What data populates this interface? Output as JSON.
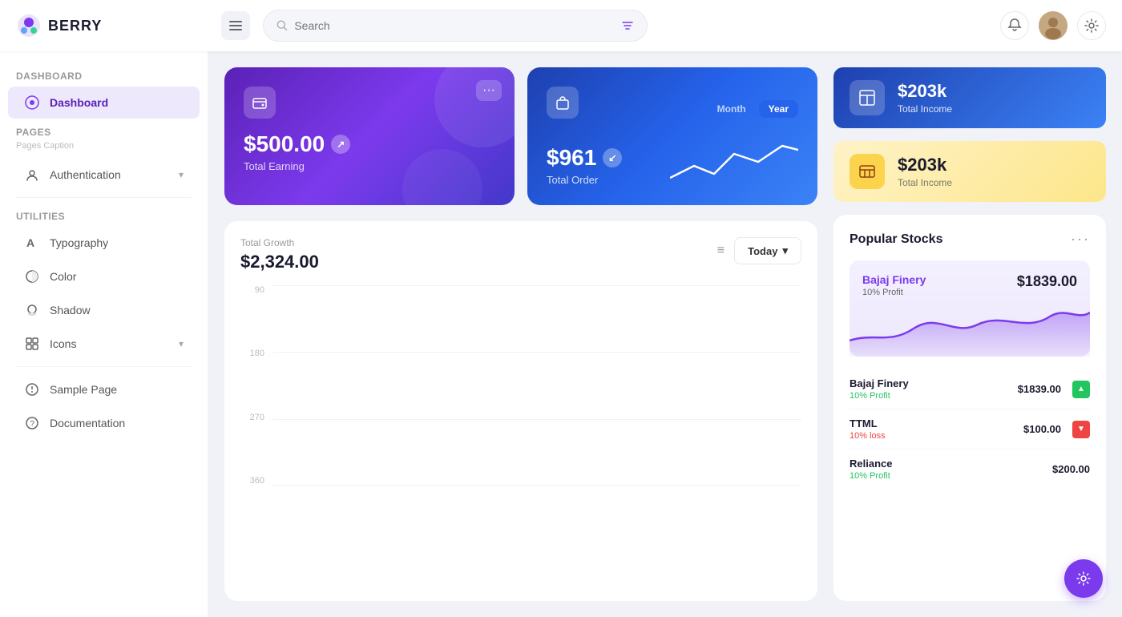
{
  "header": {
    "logo_text": "BERRY",
    "search_placeholder": "Search",
    "hamburger_label": "☰"
  },
  "sidebar": {
    "section1_label": "Dashboard",
    "dashboard_item": "Dashboard",
    "section2_label": "Pages",
    "section2_caption": "Pages Caption",
    "authentication_label": "Authentication",
    "utilities_label": "Utilities",
    "typography_label": "Typography",
    "color_label": "Color",
    "shadow_label": "Shadow",
    "icons_label": "Icons",
    "sample_page_label": "Sample Page",
    "documentation_label": "Documentation"
  },
  "cards": {
    "earning": {
      "amount": "$500.00",
      "label": "Total Earning",
      "more": "···"
    },
    "order": {
      "amount": "$961",
      "label": "Total Order",
      "toggle_month": "Month",
      "toggle_year": "Year"
    },
    "stat1": {
      "amount": "$203k",
      "label": "Total Income"
    },
    "stat2": {
      "amount": "$203k",
      "label": "Total Income"
    }
  },
  "growth": {
    "title": "Total Growth",
    "amount": "$2,324.00",
    "button_label": "Today",
    "y_labels": [
      "90",
      "180",
      "270",
      "360"
    ],
    "menu": "≡"
  },
  "stocks": {
    "title": "Popular Stocks",
    "more": "···",
    "featured": {
      "name": "Bajaj Finery",
      "price": "$1839.00",
      "profit": "10% Profit"
    },
    "rows": [
      {
        "name": "Bajaj Finery",
        "price": "$1839.00",
        "sub": "10% Profit",
        "trend": "up"
      },
      {
        "name": "TTML",
        "price": "$100.00",
        "sub": "10% loss",
        "trend": "down"
      },
      {
        "name": "Reliance",
        "price": "$200.00",
        "sub": "10% Profit",
        "trend": "up"
      }
    ]
  },
  "fab": "⚙"
}
